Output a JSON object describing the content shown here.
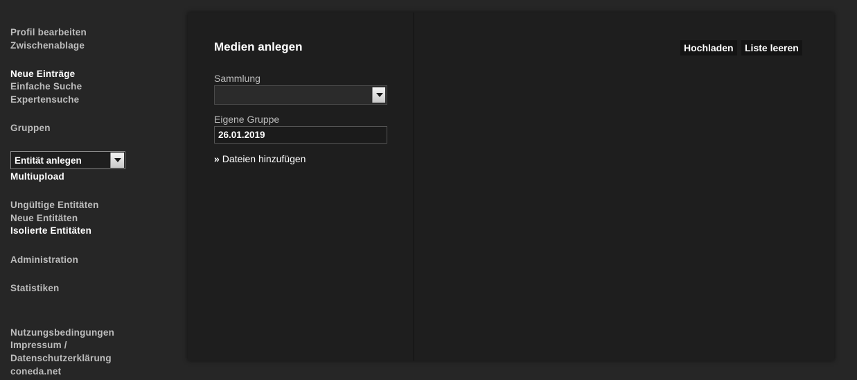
{
  "sidebar": {
    "items": [
      {
        "label": "Profil bearbeiten"
      },
      {
        "label": "Zwischenablage"
      },
      {
        "label": "Neue Einträge"
      },
      {
        "label": "Einfache Suche"
      },
      {
        "label": "Expertensuche"
      },
      {
        "label": "Gruppen"
      },
      {
        "label": "Multiupload"
      },
      {
        "label": "Ungültige Entitäten"
      },
      {
        "label": "Neue Entitäten"
      },
      {
        "label": "Isolierte Entitäten"
      },
      {
        "label": "Administration"
      },
      {
        "label": "Statistiken"
      },
      {
        "label": "Nutzungsbedingungen"
      },
      {
        "label": "Impressum /"
      },
      {
        "label": "Datenschutzerklärung"
      },
      {
        "label": "coneda.net"
      }
    ],
    "entity_select": {
      "selected": "Entität anlegen"
    }
  },
  "main": {
    "title": "Medien anlegen",
    "collection": {
      "label": "Sammlung",
      "selected": ""
    },
    "own_group": {
      "label": "Eigene Gruppe",
      "value": "26.01.2019"
    },
    "add_files": {
      "marker": "»",
      "label": "Dateien hinzufügen"
    },
    "toolbar": {
      "upload_label": "Hochladen",
      "clear_label": "Liste leeren"
    }
  },
  "colors": {
    "background": "#262626",
    "panel": "#1e1e1e",
    "text_active": "#ffffff",
    "text_muted": "#bdbdbd"
  }
}
